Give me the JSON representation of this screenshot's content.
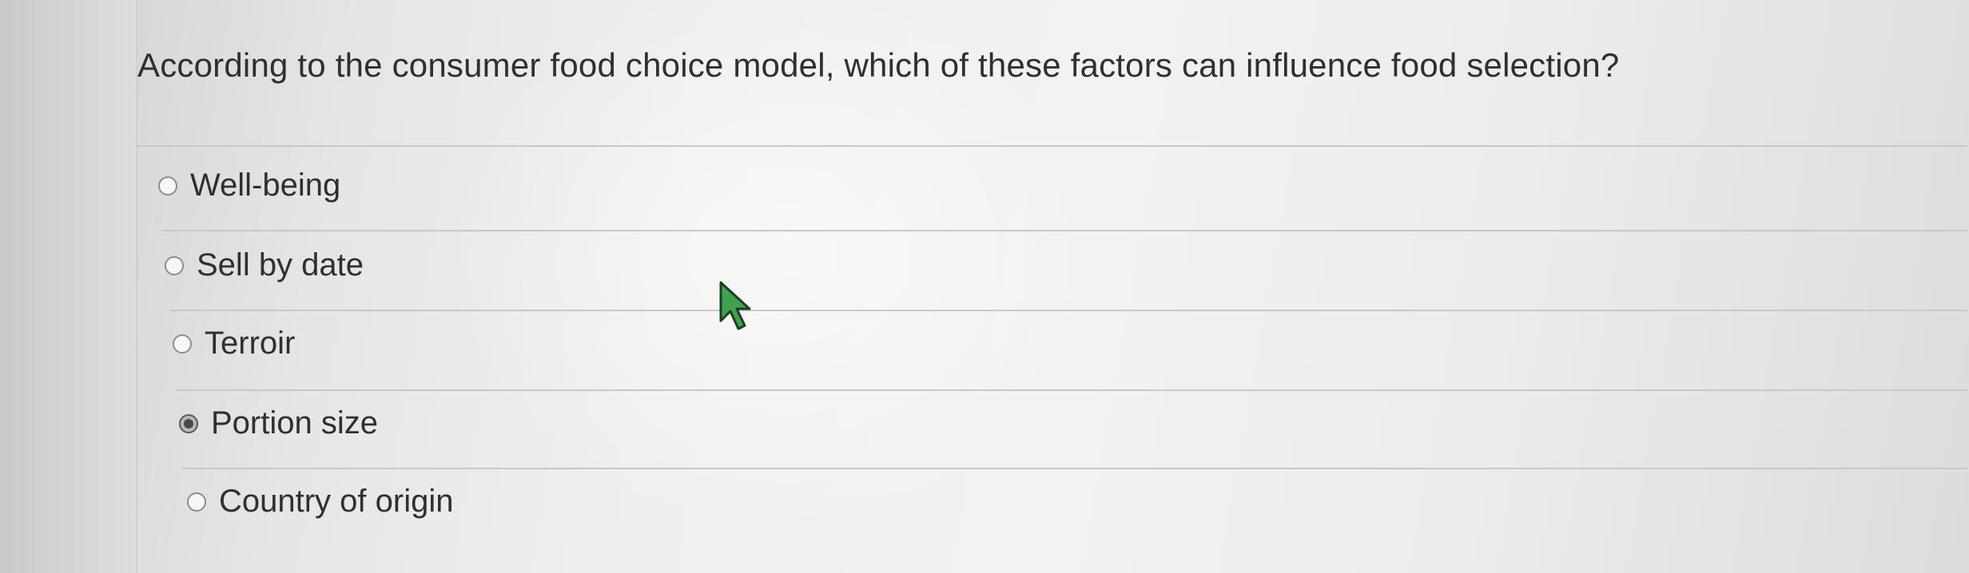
{
  "question": {
    "text": "According to the consumer food choice model, which of these factors can influence food selection?"
  },
  "options": [
    {
      "label": "Well-being",
      "selected": false
    },
    {
      "label": "Sell by date",
      "selected": false
    },
    {
      "label": "Terroir",
      "selected": false
    },
    {
      "label": "Portion size",
      "selected": true
    },
    {
      "label": "Country of origin",
      "selected": false
    }
  ],
  "colors": {
    "text": "#2f2f2f",
    "cursor": "#3fa34d"
  },
  "icons": {
    "cursor": "arrow-pointer-icon",
    "radio": "radio-button-icon"
  }
}
